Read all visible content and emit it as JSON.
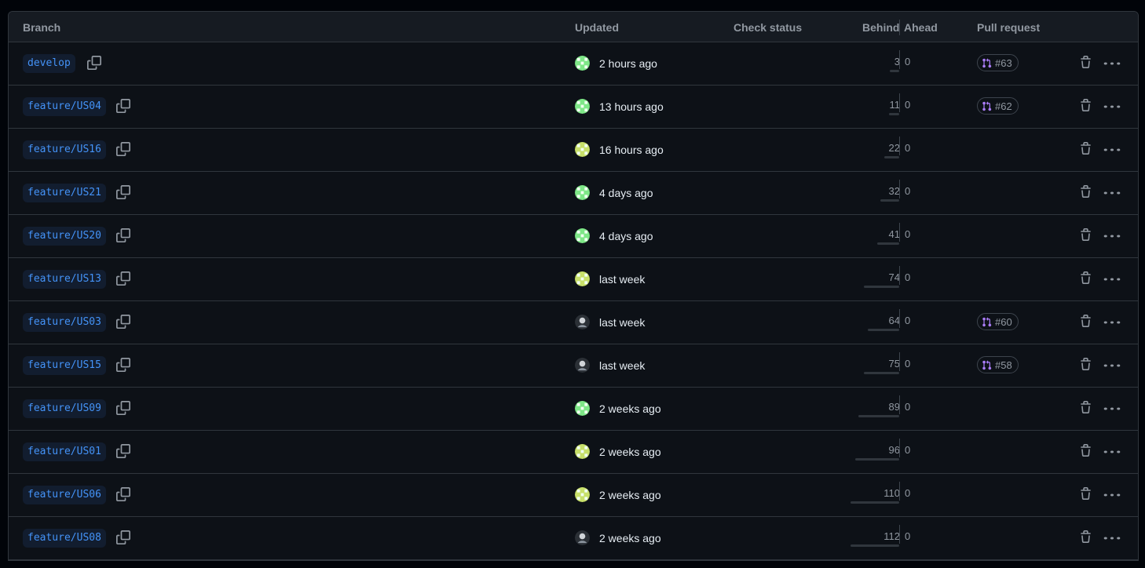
{
  "header": {
    "branch": "Branch",
    "updated": "Updated",
    "check_status": "Check status",
    "behind": "Behind",
    "ahead": "Ahead",
    "pull_request": "Pull request"
  },
  "colors": {
    "branch_text": "#4493f8",
    "pr_icon": "#ab7df8",
    "avatar_green": "#7ee787",
    "avatar_lime": "#c8e06a",
    "avatar_dark": "#3a3f44"
  },
  "rows": [
    {
      "branch": "develop",
      "updated": "2 hours ago",
      "avatar": "green",
      "behind": "3",
      "ahead": "0",
      "pr": "#63"
    },
    {
      "branch": "feature/US04",
      "updated": "13 hours ago",
      "avatar": "green",
      "behind": "11",
      "ahead": "0",
      "pr": "#62"
    },
    {
      "branch": "feature/US16",
      "updated": "16 hours ago",
      "avatar": "lime",
      "behind": "22",
      "ahead": "0",
      "pr": ""
    },
    {
      "branch": "feature/US21",
      "updated": "4 days ago",
      "avatar": "green",
      "behind": "32",
      "ahead": "0",
      "pr": ""
    },
    {
      "branch": "feature/US20",
      "updated": "4 days ago",
      "avatar": "green",
      "behind": "41",
      "ahead": "0",
      "pr": ""
    },
    {
      "branch": "feature/US13",
      "updated": "last week",
      "avatar": "lime",
      "behind": "74",
      "ahead": "0",
      "pr": ""
    },
    {
      "branch": "feature/US03",
      "updated": "last week",
      "avatar": "dark",
      "behind": "64",
      "ahead": "0",
      "pr": "#60"
    },
    {
      "branch": "feature/US15",
      "updated": "last week",
      "avatar": "dark",
      "behind": "75",
      "ahead": "0",
      "pr": "#58"
    },
    {
      "branch": "feature/US09",
      "updated": "2 weeks ago",
      "avatar": "green",
      "behind": "89",
      "ahead": "0",
      "pr": ""
    },
    {
      "branch": "feature/US01",
      "updated": "2 weeks ago",
      "avatar": "lime",
      "behind": "96",
      "ahead": "0",
      "pr": ""
    },
    {
      "branch": "feature/US06",
      "updated": "2 weeks ago",
      "avatar": "lime",
      "behind": "110",
      "ahead": "0",
      "pr": ""
    },
    {
      "branch": "feature/US08",
      "updated": "2 weeks ago",
      "avatar": "dark",
      "behind": "112",
      "ahead": "0",
      "pr": ""
    }
  ]
}
